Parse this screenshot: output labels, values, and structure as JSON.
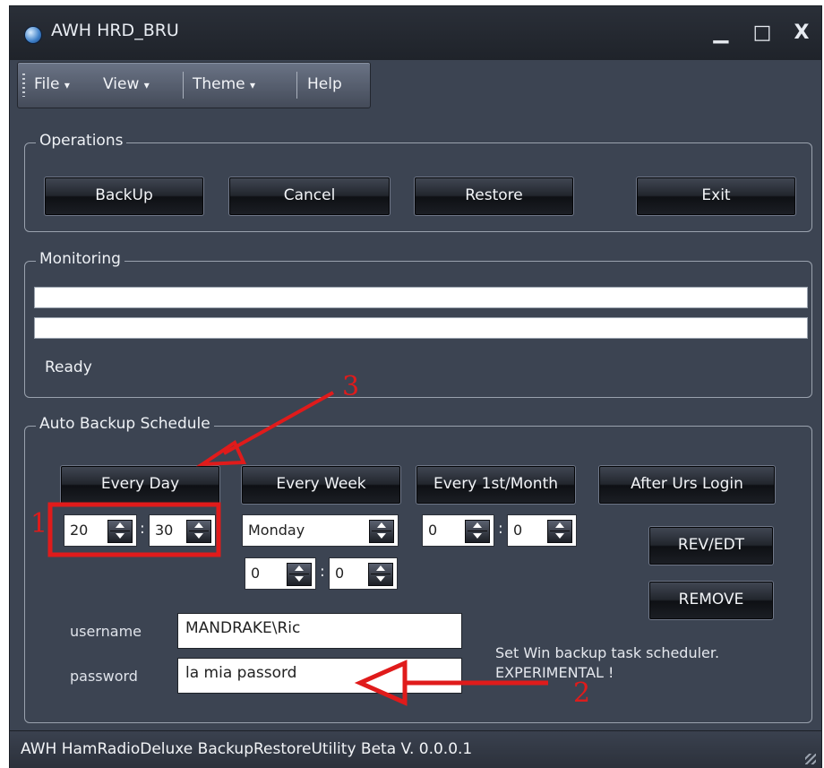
{
  "window": {
    "title": "AWH HRD_BRU",
    "controls": {
      "minimize": "▁",
      "maximize": "□",
      "close": "X"
    }
  },
  "menubar": {
    "items": [
      {
        "label": "File",
        "arrow": "▾"
      },
      {
        "label": "View",
        "arrow": "▾"
      },
      {
        "label": "Theme",
        "arrow": "▾"
      },
      {
        "label": "Help"
      }
    ]
  },
  "operations": {
    "legend": "Operations",
    "buttons": {
      "backup": "BackUp",
      "cancel": "Cancel",
      "restore": "Restore",
      "exit": "Exit"
    }
  },
  "monitoring": {
    "legend": "Monitoring",
    "progress_1": 0,
    "progress_2": 0,
    "status": "Ready"
  },
  "schedule": {
    "legend": "Auto Backup Schedule",
    "buttons": {
      "every_day": "Every Day",
      "every_week": "Every Week",
      "every_month": "Every 1st/Month",
      "after_login": "After Urs Login",
      "rev_edt": "REV/EDT",
      "remove": "REMOVE"
    },
    "day_hour": "20",
    "day_minute": "30",
    "week_day": "Monday",
    "week_hour": "0",
    "week_minute": "0",
    "month_hour": "0",
    "month_minute": "0",
    "time_separator": ":",
    "username_label": "username",
    "username_value": "MANDRAKE\\Ric",
    "password_label": "password",
    "password_value": "la mia passord",
    "note_line1": "Set Win backup task scheduler.",
    "note_line2": "EXPERIMENTAL !"
  },
  "footer": {
    "text": "AWH HamRadioDeluxe BackupRestoreUtility Beta V. 0.0.0.1"
  },
  "annotations": {
    "n1": "1",
    "n2": "2",
    "n3": "3",
    "color": "#e01b1b"
  }
}
